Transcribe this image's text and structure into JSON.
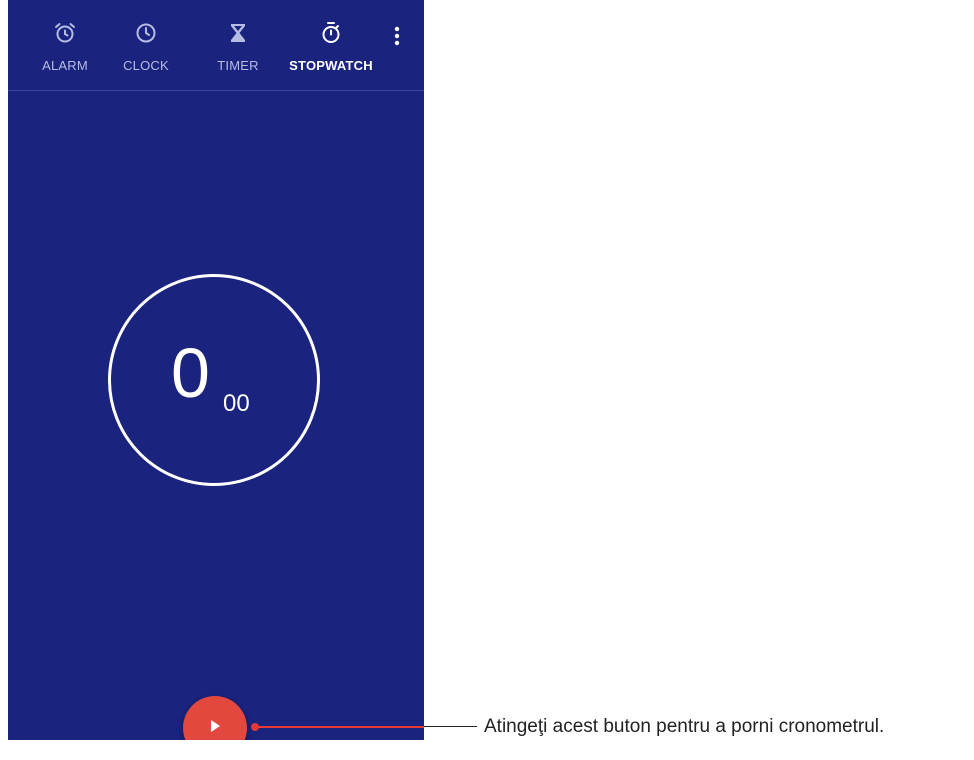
{
  "tabs": [
    {
      "id": "alarm",
      "label": "ALARM",
      "icon": "alarm-icon"
    },
    {
      "id": "clock",
      "label": "CLOCK",
      "icon": "clock-icon"
    },
    {
      "id": "timer",
      "label": "TIMER",
      "icon": "hourglass-icon"
    },
    {
      "id": "stopwatch",
      "label": "STOPWATCH",
      "icon": "stopwatch-icon",
      "active": true
    }
  ],
  "menu": {
    "icon": "more-vert-icon"
  },
  "stopwatch": {
    "seconds": "0",
    "hundredths": "00"
  },
  "start_button": {
    "icon": "play-icon"
  },
  "callout": {
    "text": "Atingeţi acest buton pentru a porni cronometrul."
  },
  "colors": {
    "background": "#1a237e",
    "accent": "#e2483d",
    "callout_line": "#e53935"
  }
}
